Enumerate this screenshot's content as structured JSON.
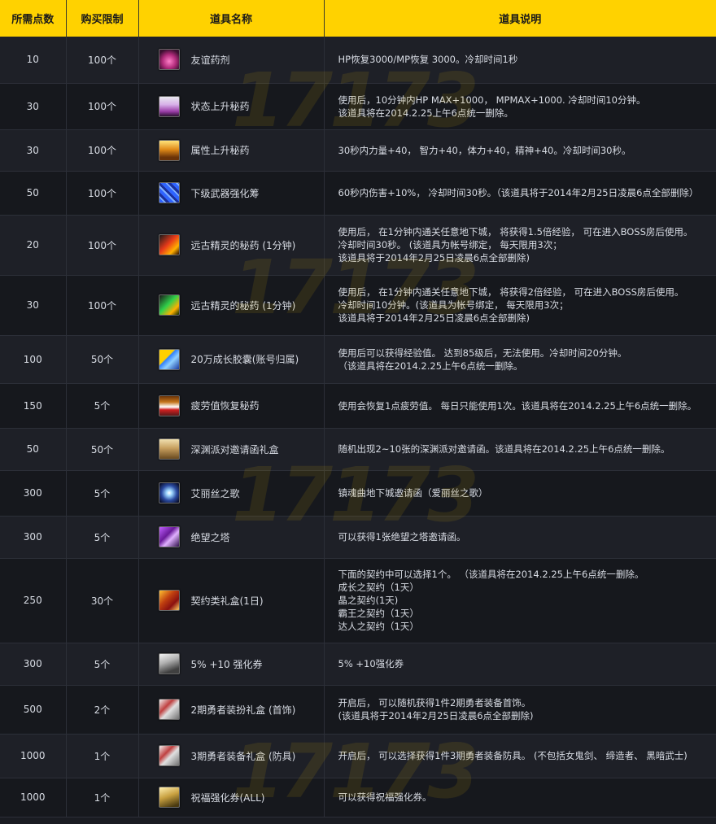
{
  "headers": {
    "points": "所需点数",
    "limit": "购买限制",
    "name": "道具名称",
    "desc": "道具说明"
  },
  "rows": [
    {
      "points": "10",
      "limit": "100个",
      "name": "友谊药剂",
      "icon": "pink-potion-icon",
      "desc": [
        "HP恢复3000/MP恢复 3000。冷却时间1秒"
      ]
    },
    {
      "points": "30",
      "limit": "100个",
      "name": "状态上升秘药",
      "icon": "potion-jar-icon",
      "desc": [
        "使用后，10分钟内HP MAX+1000， MPMAX+1000. 冷却时间10分钟。",
        "该道具将在2014.2.25上午6点统一删除。"
      ]
    },
    {
      "points": "30",
      "limit": "100个",
      "name": "属性上升秘药",
      "icon": "orange-potion-icon",
      "desc": [
        "30秒内力量+40， 智力+40，体力+40，精神+40。冷却时间30秒。"
      ]
    },
    {
      "points": "50",
      "limit": "100个",
      "name": "下级武器强化筹",
      "icon": "blue-talisman-icon",
      "desc": [
        "60秒内伤害+10%， 冷却时间30秒。（该道具将于2014年2月25日凌晨6点全部删除）"
      ]
    },
    {
      "points": "20",
      "limit": "100个",
      "name": "远古精灵的秘药 (1分钟)",
      "icon": "exp-potion-red-icon",
      "desc": [
        "使用后， 在1分钟内通关任意地下城， 将获得1.5倍经验， 可在进入BOSS房后使用。",
        "冷却时间30秒。 (该道具为帐号绑定， 每天限用3次；",
        "该道具将于2014年2月25日凌晨6点全部删除)"
      ]
    },
    {
      "points": "30",
      "limit": "100个",
      "name": "远古精灵的秘药 (1分钟)",
      "icon": "exp-potion-green-icon",
      "desc": [
        "使用后， 在1分钟内通关任意地下城， 将获得2倍经验， 可在进入BOSS房后使用。",
        "冷却时间10分钟。(该道具为帐号绑定， 每天限用3次；",
        "该道具将于2014年2月25日凌晨6点全部删除)"
      ]
    },
    {
      "points": "100",
      "limit": "50个",
      "name": "20万成长胶囊(账号归属)",
      "icon": "capsule-icon",
      "desc": [
        "使用后可以获得经验值。 达到85级后，无法使用。冷却时间20分钟。",
        "（该道具将在2014.2.25上午6点统一删除。"
      ]
    },
    {
      "points": "150",
      "limit": "5个",
      "name": "疲劳值恢复秘药",
      "icon": "fatigue-potion-icon",
      "desc": [
        "使用会恢复1点疲劳值。 每日只能使用1次。该道具将在2014.2.25上午6点统一删除。"
      ]
    },
    {
      "points": "50",
      "limit": "50个",
      "name": "深渊派对邀请函礼盒",
      "icon": "gift-chest-icon",
      "desc": [
        "随机出现2~10张的深渊派对邀请函。该道具将在2014.2.25上午6点统一删除。"
      ]
    },
    {
      "points": "300",
      "limit": "5个",
      "name": "艾丽丝之歌",
      "icon": "light-burst-icon",
      "desc": [
        "镇魂曲地下城邀请函（爱丽丝之歌）"
      ]
    },
    {
      "points": "300",
      "limit": "5个",
      "name": "绝望之塔",
      "icon": "tower-ticket-icon",
      "desc": [
        "可以获得1张绝望之塔邀请函。"
      ]
    },
    {
      "points": "250",
      "limit": "30个",
      "name": "契约类礼盒(1日)",
      "icon": "contract-box-icon",
      "desc": [
        "下面的契约中可以选择1个。 （该道具将在2014.2.25上午6点统一删除。",
        "成长之契约（1天）",
        "晶之契约(1天)",
        "霸王之契约（1天）",
        "达人之契约（1天）"
      ]
    },
    {
      "points": "300",
      "limit": "5个",
      "name": "5% +10 强化券",
      "icon": "enhance-ticket-icon",
      "desc": [
        "5% +10强化券"
      ]
    },
    {
      "points": "500",
      "limit": "2个",
      "name": "2期勇者装扮礼盒 (首饰)",
      "icon": "hero-box-icon",
      "desc": [
        "开启后， 可以随机获得1件2期勇者装备首饰。",
        "(该道具将于2014年2月25日凌晨6点全部删除)"
      ]
    },
    {
      "points": "1000",
      "limit": "1个",
      "name": "3期勇者装备礼盒 (防具)",
      "icon": "hero-box-icon",
      "desc": [
        "开启后， 可以选择获得1件3期勇者装备防具。 (不包括女鬼剑、 缔造者、 黑暗武士)"
      ]
    },
    {
      "points": "1000",
      "limit": "1个",
      "name": "祝福强化券(ALL)",
      "icon": "blessing-ticket-icon",
      "desc": [
        "可以获得祝福强化券。"
      ]
    }
  ],
  "watermark": "17173",
  "colors": {
    "header_bg": "#ffd200",
    "row_odd": "#1e2027",
    "row_even": "#16181d",
    "text": "#d8dce4"
  }
}
